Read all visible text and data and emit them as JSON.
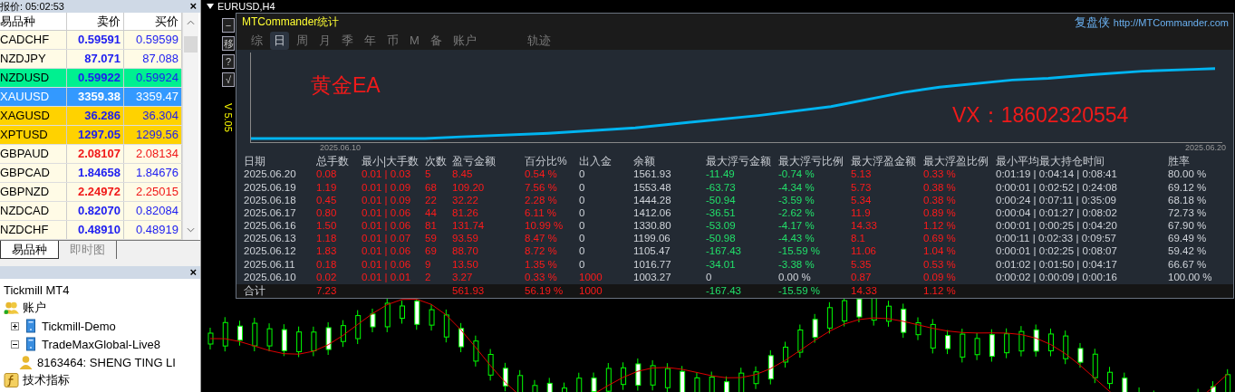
{
  "market_watch": {
    "title": "报价: 05:02:53",
    "close_button": "×",
    "columns": [
      "易品种",
      "卖价",
      "买价"
    ],
    "rows": [
      {
        "symbol": "CADCHF",
        "bid": "0.59591",
        "ask": "0.59599",
        "kind": "plain",
        "color": "#1d1df0",
        "selected": false
      },
      {
        "symbol": "NZDJPY",
        "bid": "87.071",
        "ask": "87.088",
        "kind": "plain",
        "color": "#1d1df0",
        "selected": false
      },
      {
        "symbol": "NZDUSD",
        "bid": "0.59922",
        "ask": "0.59924",
        "kind": "green",
        "color": "#1d1df0",
        "selected": false
      },
      {
        "symbol": "XAUUSD",
        "bid": "3359.38",
        "ask": "3359.47",
        "selected": true
      },
      {
        "symbol": "XAGUSD",
        "bid": "36.286",
        "ask": "36.304",
        "kind": "gold",
        "color": "#1d1df0",
        "selected": false
      },
      {
        "symbol": "XPTUSD",
        "bid": "1297.05",
        "ask": "1299.56",
        "kind": "gold",
        "color": "#1d1df0",
        "selected": false
      },
      {
        "symbol": "GBPAUD",
        "bid": "2.08107",
        "ask": "2.08134",
        "kind": "plain",
        "color": "#f01818",
        "selected": false
      },
      {
        "symbol": "GBPCAD",
        "bid": "1.84658",
        "ask": "1.84676",
        "kind": "plain",
        "color": "#1d1df0",
        "selected": false
      },
      {
        "symbol": "GBPNZD",
        "bid": "2.24972",
        "ask": "2.25015",
        "kind": "plain",
        "color": "#f01818",
        "selected": false
      },
      {
        "symbol": "NZDCAD",
        "bid": "0.82070",
        "ask": "0.82084",
        "kind": "plain",
        "color": "#1d1df0",
        "selected": false
      },
      {
        "symbol": "NZDCHF",
        "bid": "0.48910",
        "ask": "0.48919",
        "kind": "plain",
        "color": "#1d1df0",
        "selected": false
      }
    ],
    "tabs": [
      {
        "label": "易品种",
        "selected": true
      },
      {
        "label": "即时图",
        "selected": false
      }
    ]
  },
  "navigator": {
    "close_button": "×",
    "tree": [
      {
        "label": "Tickmill MT4",
        "kind": "root"
      },
      {
        "label": "账户",
        "kind": "accounts",
        "children": [
          {
            "label": "Tickmill-Demo",
            "kind": "server",
            "expanded": false
          },
          {
            "label": "TradeMaxGlobal-Live8",
            "kind": "server",
            "expanded": true,
            "children": [
              {
                "label": "8163464: SHENG TING LI",
                "kind": "account"
              }
            ]
          }
        ]
      },
      {
        "label": "技术指标",
        "kind": "indicators"
      }
    ]
  },
  "chart_window": {
    "title": "EURUSD,H4",
    "side_buttons": [
      "−",
      "移",
      "?",
      "√"
    ],
    "version": "V 5.05"
  },
  "stats_panel": {
    "title": "MTCommander统计",
    "brand": "复盘侠",
    "link": "http://MTCommander.com",
    "tabs": [
      {
        "label": "综",
        "selected": false
      },
      {
        "label": "日",
        "selected": true
      },
      {
        "label": "周",
        "selected": false
      },
      {
        "label": "月",
        "selected": false
      },
      {
        "label": "季",
        "selected": false
      },
      {
        "label": "年",
        "selected": false
      },
      {
        "label": "币",
        "selected": false
      },
      {
        "label": "M",
        "selected": false
      },
      {
        "label": "备",
        "selected": false
      },
      {
        "label": "账户",
        "selected": false
      },
      {
        "label": "轨迹",
        "selected": false
      }
    ],
    "equity_chart": {
      "start_label": "2025.06.10",
      "end_label": "2025.06.20",
      "overlay_title": "黄金EA",
      "overlay_contact": "VX：18602320554"
    },
    "table": {
      "columns": [
        {
          "label": "日期",
          "kind": "plain"
        },
        {
          "label": "总手数",
          "kind": "profit"
        },
        {
          "label": "最小|大手数",
          "kind": "profit"
        },
        {
          "label": "次数",
          "kind": "profit"
        },
        {
          "label": "盈亏金额",
          "kind": "profit"
        },
        {
          "label": "百分比%",
          "kind": "profit"
        },
        {
          "label": "出入金",
          "kind": "profit"
        },
        {
          "label": "余额",
          "kind": "plain"
        },
        {
          "label": "最大浮亏金额",
          "kind": "loss"
        },
        {
          "label": "最大浮亏比例",
          "kind": "loss"
        },
        {
          "label": "最大浮盈金额",
          "kind": "profit"
        },
        {
          "label": "最大浮盈比例",
          "kind": "profit"
        },
        {
          "label": "最小平均最大持仓时间",
          "kind": "plain"
        },
        {
          "label": "胜率",
          "kind": "plain"
        }
      ],
      "rows": [
        [
          "2025.06.20",
          "0.08",
          "0.01 | 0.03",
          "5",
          "8.45",
          "0.54 %",
          "0",
          "1561.93",
          "-11.49",
          "-0.74 %",
          "5.13",
          "0.33 %",
          "0:01:19 | 0:04:14 | 0:08:41",
          "80.00 %"
        ],
        [
          "2025.06.19",
          "1.19",
          "0.01 | 0.09",
          "68",
          "109.20",
          "7.56 %",
          "0",
          "1553.48",
          "-63.73",
          "-4.34 %",
          "5.73",
          "0.38 %",
          "0:00:01 | 0:02:52 | 0:24:08",
          "69.12 %"
        ],
        [
          "2025.06.18",
          "0.45",
          "0.01 | 0.09",
          "22",
          "32.22",
          "2.28 %",
          "0",
          "1444.28",
          "-50.94",
          "-3.59 %",
          "5.34",
          "0.38 %",
          "0:00:24 | 0:07:11 | 0:35:09",
          "68.18 %"
        ],
        [
          "2025.06.17",
          "0.80",
          "0.01 | 0.06",
          "44",
          "81.26",
          "6.11 %",
          "0",
          "1412.06",
          "-36.51",
          "-2.62 %",
          "11.9",
          "0.89 %",
          "0:00:04 | 0:01:27 | 0:08:02",
          "72.73 %"
        ],
        [
          "2025.06.16",
          "1.50",
          "0.01 | 0.06",
          "81",
          "131.74",
          "10.99 %",
          "0",
          "1330.80",
          "-53.09",
          "-4.17 %",
          "14.33",
          "1.12 %",
          "0:00:01 | 0:00:25 | 0:04:20",
          "67.90 %"
        ],
        [
          "2025.06.13",
          "1.18",
          "0.01 | 0.07",
          "59",
          "93.59",
          "8.47 %",
          "0",
          "1199.06",
          "-50.98",
          "-4.43 %",
          "8.1",
          "0.69 %",
          "0:00:11 | 0:02:33 | 0:09:57",
          "69.49 %"
        ],
        [
          "2025.06.12",
          "1.83",
          "0.01 | 0.06",
          "69",
          "88.70",
          "8.72 %",
          "0",
          "1105.47",
          "-167.43",
          "-15.59 %",
          "11.06",
          "1.04 %",
          "0:00:01 | 0:02:25 | 0:08:07",
          "59.42 %"
        ],
        [
          "2025.06.11",
          "0.18",
          "0.01 | 0.06",
          "9",
          "13.50",
          "1.35 %",
          "0",
          "1016.77",
          "-34.01",
          "-3.38 %",
          "5.35",
          "0.53 %",
          "0:01:02 | 0:01:50 | 0:04:17",
          "66.67 %"
        ],
        [
          "2025.06.10",
          "0.02",
          "0.01 | 0.01",
          "2",
          "3.27",
          "0.33 %",
          "1000",
          "1003.27",
          "0",
          "0.00 %",
          "0.87",
          "0.09 %",
          "0:00:02 | 0:00:09 | 0:00:16",
          "100.00 %"
        ]
      ],
      "totals": [
        {
          "kind": "value",
          "value": "合计"
        },
        {
          "kind": "value",
          "value": "7.23"
        },
        {
          "kind": "blank"
        },
        {
          "kind": "blank"
        },
        {
          "kind": "value",
          "value": "561.93"
        },
        {
          "kind": "value",
          "value": "56.19 %"
        },
        {
          "kind": "value",
          "value": "1000"
        },
        {
          "kind": "blank"
        },
        {
          "kind": "value",
          "value": "-167.43"
        },
        {
          "kind": "value",
          "value": "-15.59 %"
        },
        {
          "kind": "value",
          "value": "14.33"
        },
        {
          "kind": "value",
          "value": "1.12 %"
        },
        {
          "kind": "blank"
        },
        {
          "kind": "blank"
        }
      ]
    }
  }
}
